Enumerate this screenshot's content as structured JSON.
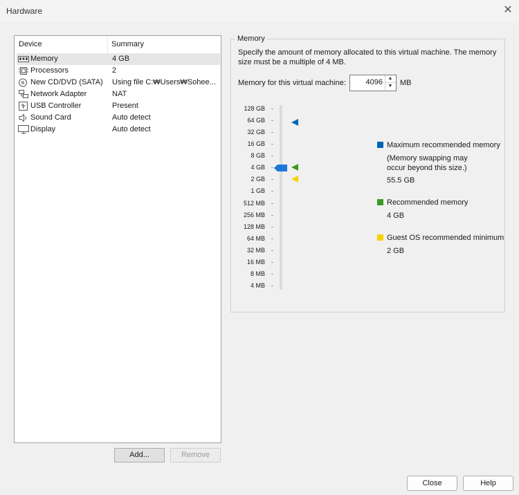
{
  "window": {
    "title": "Hardware"
  },
  "device_list": {
    "headers": {
      "device": "Device",
      "summary": "Summary"
    },
    "rows": [
      {
        "device": "Memory",
        "summary": "4 GB",
        "icon": "memory-icon",
        "selected": true
      },
      {
        "device": "Processors",
        "summary": "2",
        "icon": "processor-icon"
      },
      {
        "device": "New CD/DVD (SATA)",
        "summary": "Using file C:₩Users₩Sohee...",
        "icon": "cd-dvd-icon"
      },
      {
        "device": "Network Adapter",
        "summary": "NAT",
        "icon": "network-adapter-icon"
      },
      {
        "device": "USB Controller",
        "summary": "Present",
        "icon": "usb-icon"
      },
      {
        "device": "Sound Card",
        "summary": "Auto detect",
        "icon": "speaker-icon"
      },
      {
        "device": "Display",
        "summary": "Auto detect",
        "icon": "monitor-icon"
      }
    ],
    "add_label": "Add...",
    "remove_label": "Remove"
  },
  "memory": {
    "group_title": "Memory",
    "description": "Specify the amount of memory allocated to this virtual machine. The memory size must be a multiple of 4 MB.",
    "field_label": "Memory for this virtual machine:",
    "value": "4096",
    "unit": "MB",
    "scale": [
      "128 GB",
      "64 GB",
      "32 GB",
      "16 GB",
      "8 GB",
      "4 GB",
      "2 GB",
      "1 GB",
      "512 MB",
      "256 MB",
      "128 MB",
      "64 MB",
      "32 MB",
      "16 MB",
      "8 MB",
      "4 MB"
    ],
    "legend": {
      "max_title": "Maximum recommended memory",
      "max_note": "(Memory swapping may occur beyond this size.)",
      "max_value": "55.5 GB",
      "rec_title": "Recommended memory",
      "rec_value": "4 GB",
      "min_title": "Guest OS recommended minimum",
      "min_value": "2 GB"
    },
    "colors": {
      "max": "#0064b4",
      "recommended": "#3c9b23",
      "minimum": "#f5d200",
      "slider": "#1e78dc"
    }
  },
  "footer": {
    "close_label": "Close",
    "help_label": "Help"
  }
}
